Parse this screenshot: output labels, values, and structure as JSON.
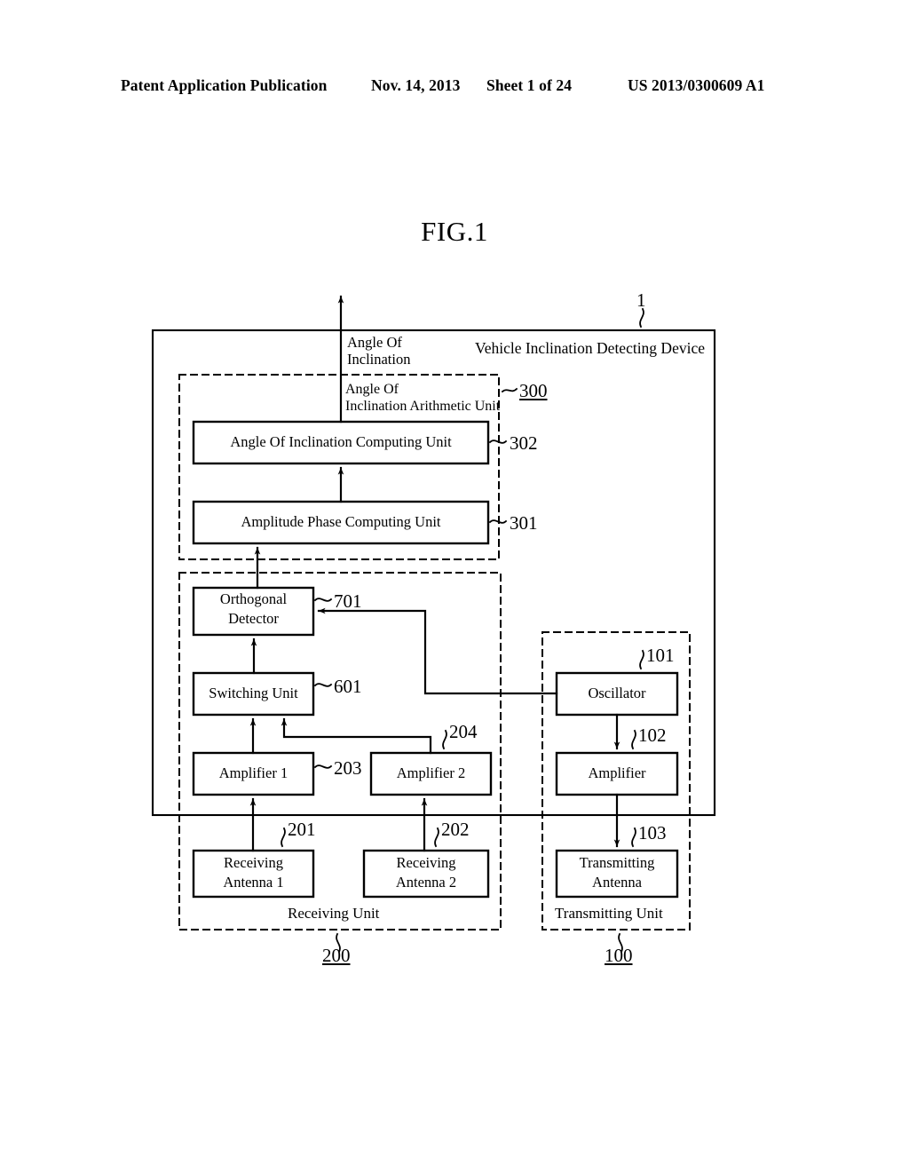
{
  "header": {
    "publication": "Patent Application Publication",
    "date": "Nov. 14, 2013",
    "sheet": "Sheet 1 of 24",
    "patent_number": "US 2013/0300609 A1"
  },
  "figure": {
    "title": "FIG.1",
    "device_label": "Vehicle Inclination Detecting Device",
    "device_ref": "1",
    "output_label_line1": "Angle Of",
    "output_label_line2": "Inclination"
  },
  "groups": [
    {
      "name": "Angle Of Inclination Arithmetic Unit",
      "label_line1": "Angle Of",
      "label_line2": "Inclination Arithmetic Unit",
      "ref": "300"
    },
    {
      "name": "Receiving Unit",
      "label": "Receiving Unit",
      "ref": "200"
    },
    {
      "name": "Transmitting Unit",
      "label": "Transmitting Unit",
      "ref": "100"
    }
  ],
  "blocks": [
    {
      "id": "b302",
      "label": "Angle Of Inclination Computing Unit",
      "ref": "302"
    },
    {
      "id": "b301",
      "label": "Amplitude Phase Computing Unit",
      "ref": "301"
    },
    {
      "id": "b701",
      "label_line1": "Orthogonal",
      "label_line2": "Detector",
      "ref": "701"
    },
    {
      "id": "b601",
      "label": "Switching Unit",
      "ref": "601"
    },
    {
      "id": "b203",
      "label": "Amplifier 1",
      "ref": "203"
    },
    {
      "id": "b204",
      "label": "Amplifier 2",
      "ref": "204"
    },
    {
      "id": "b201",
      "label_line1": "Receiving",
      "label_line2": "Antenna 1",
      "ref": "201"
    },
    {
      "id": "b202",
      "label_line1": "Receiving",
      "label_line2": "Antenna 2",
      "ref": "202"
    },
    {
      "id": "b101",
      "label": "Oscillator",
      "ref": "101"
    },
    {
      "id": "b102",
      "label": "Amplifier",
      "ref": "102"
    },
    {
      "id": "b103",
      "label_line1": "Transmitting",
      "label_line2": "Antenna",
      "ref": "103"
    }
  ],
  "colors": {
    "ink": "#000000",
    "paper": "#ffffff"
  }
}
